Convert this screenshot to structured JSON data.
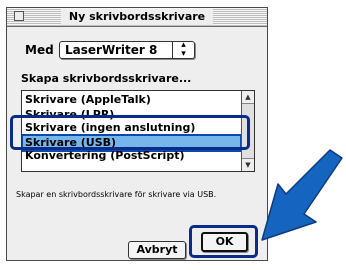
{
  "window": {
    "title": "Ny skrivbordsskrivare"
  },
  "driver": {
    "label": "Med",
    "selected": "LaserWriter 8"
  },
  "create_heading": "Skapa skrivbordsskrivare...",
  "printer_list": {
    "items": [
      "Skrivare (AppleTalk)",
      "Skrivare (LPR)",
      "Skrivare (ingen anslutning)",
      "Skrivare (USB)",
      "Konvertering (PostScript)"
    ],
    "selected_index": 3
  },
  "description": "Skapar en skrivbordsskrivare för skrivare via USB.",
  "buttons": {
    "cancel": "Avbryt",
    "ok": "OK"
  },
  "colors": {
    "highlight_ring": "#0b2b8a",
    "selection": "#77b6ea",
    "arrow": "#1565c0"
  }
}
